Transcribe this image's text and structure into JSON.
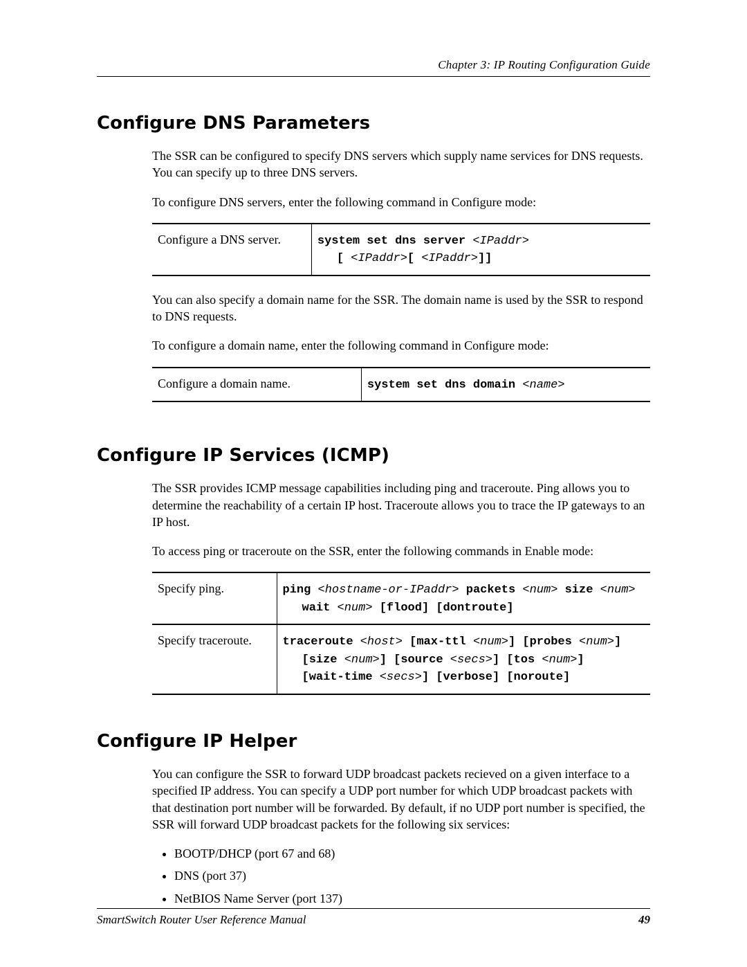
{
  "running_head": "Chapter 3: IP Routing Configuration Guide",
  "sections": {
    "dns": {
      "title": "Configure DNS Parameters",
      "p1": "The SSR can be configured to specify DNS servers which supply name services for DNS requests. You can specify up to three DNS servers.",
      "p2": "To configure DNS servers, enter the following command in Configure mode:",
      "table1": {
        "desc": "Configure a DNS server.",
        "cmd_b1": "system set dns server ",
        "cmd_i1": "<IPaddr>",
        "cmd_l2_b1": "[ ",
        "cmd_l2_i1": "<IPaddr>",
        "cmd_l2_b2": "[ ",
        "cmd_l2_i2": "<IPaddr>",
        "cmd_l2_b3": "]]"
      },
      "p3": "You can also specify a domain name for the SSR. The domain name is used by the SSR to respond to DNS requests.",
      "p4": "To configure a domain name, enter the following command in Configure mode:",
      "table2": {
        "desc": "Configure a domain name.",
        "cmd_b1": "system set dns domain ",
        "cmd_i1": "<name>"
      }
    },
    "icmp": {
      "title": "Configure IP Services (ICMP)",
      "p1": "The SSR provides ICMP message capabilities including ping and traceroute. Ping allows you to determine the reachability of a certain IP host. Traceroute allows you to trace the IP gateways to an IP host.",
      "p2": "To access ping or traceroute on the SSR, enter the following commands in Enable mode:",
      "row1": {
        "desc": "Specify ping.",
        "b1": "ping ",
        "i1": "<hostname-or-IPaddr>",
        "b2": " packets ",
        "i2": "<num>",
        "b3": " size ",
        "i3": "<num>",
        "l2_b1": "wait ",
        "l2_i1": "<num>",
        "l2_b2": " [flood] [dontroute]"
      },
      "row2": {
        "desc": "Specify traceroute.",
        "b1": "traceroute ",
        "i1": "<host>",
        "b2": " [max-ttl ",
        "i2": "<num>",
        "b3": "] [probes ",
        "i3": "<num>",
        "b4": "]",
        "l2_b1": "[size ",
        "l2_i1": "<num>",
        "l2_b2": "] [source ",
        "l2_i2": "<secs>",
        "l2_b3": "] [tos ",
        "l2_i3": "<num>",
        "l2_b4": "]",
        "l3_b1": "[wait-time ",
        "l3_i1": "<secs>",
        "l3_b2": "] [verbose] [noroute]"
      }
    },
    "helper": {
      "title": "Configure IP Helper",
      "p1": "You can configure the SSR to forward UDP broadcast packets recieved on a given interface to a specified IP address. You can specify a UDP port number for which UDP broadcast packets with that destination port number will be forwarded. By default, if no UDP port number is specified, the SSR will forward UDP broadcast packets for the following six services:",
      "bullets": [
        "BOOTP/DHCP (port 67 and 68)",
        "DNS (port 37)",
        "NetBIOS Name Server (port 137)"
      ]
    }
  },
  "footer": {
    "title": "SmartSwitch Router User Reference Manual",
    "page": "49"
  }
}
